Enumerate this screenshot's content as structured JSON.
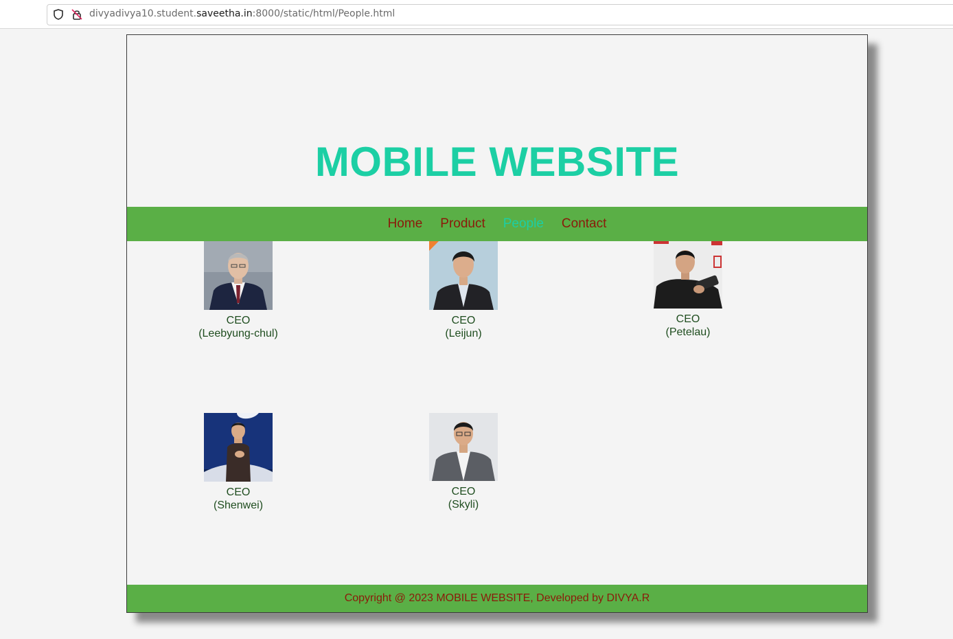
{
  "browser": {
    "url_prefix": "divyadivya10.student.",
    "url_host": "saveetha.in",
    "url_suffix": ":8000/static/html/People.html"
  },
  "site": {
    "title": "MOBILE WEBSITE",
    "nav": [
      {
        "label": "Home",
        "active": false
      },
      {
        "label": "Product",
        "active": false
      },
      {
        "label": "People",
        "active": true
      },
      {
        "label": "Contact",
        "active": false
      }
    ],
    "people": [
      {
        "role": "CEO",
        "name": "(Leebyung-chul)"
      },
      {
        "role": "CEO",
        "name": "(Leijun)"
      },
      {
        "role": "CEO",
        "name": "(Petelau)"
      },
      {
        "role": "CEO",
        "name": "(Shenwei)"
      },
      {
        "role": "CEO",
        "name": "(Skyli)"
      }
    ],
    "footer": "Copyright @ 2023 MOBILE WEBSITE, Developed by DIVYA.R"
  },
  "colors": {
    "title": "#1ccfa4",
    "nav_bg": "#5aaf46",
    "nav_link": "#8b1a0a",
    "nav_active": "#1ccfa4",
    "caption": "#1f4d1f"
  }
}
